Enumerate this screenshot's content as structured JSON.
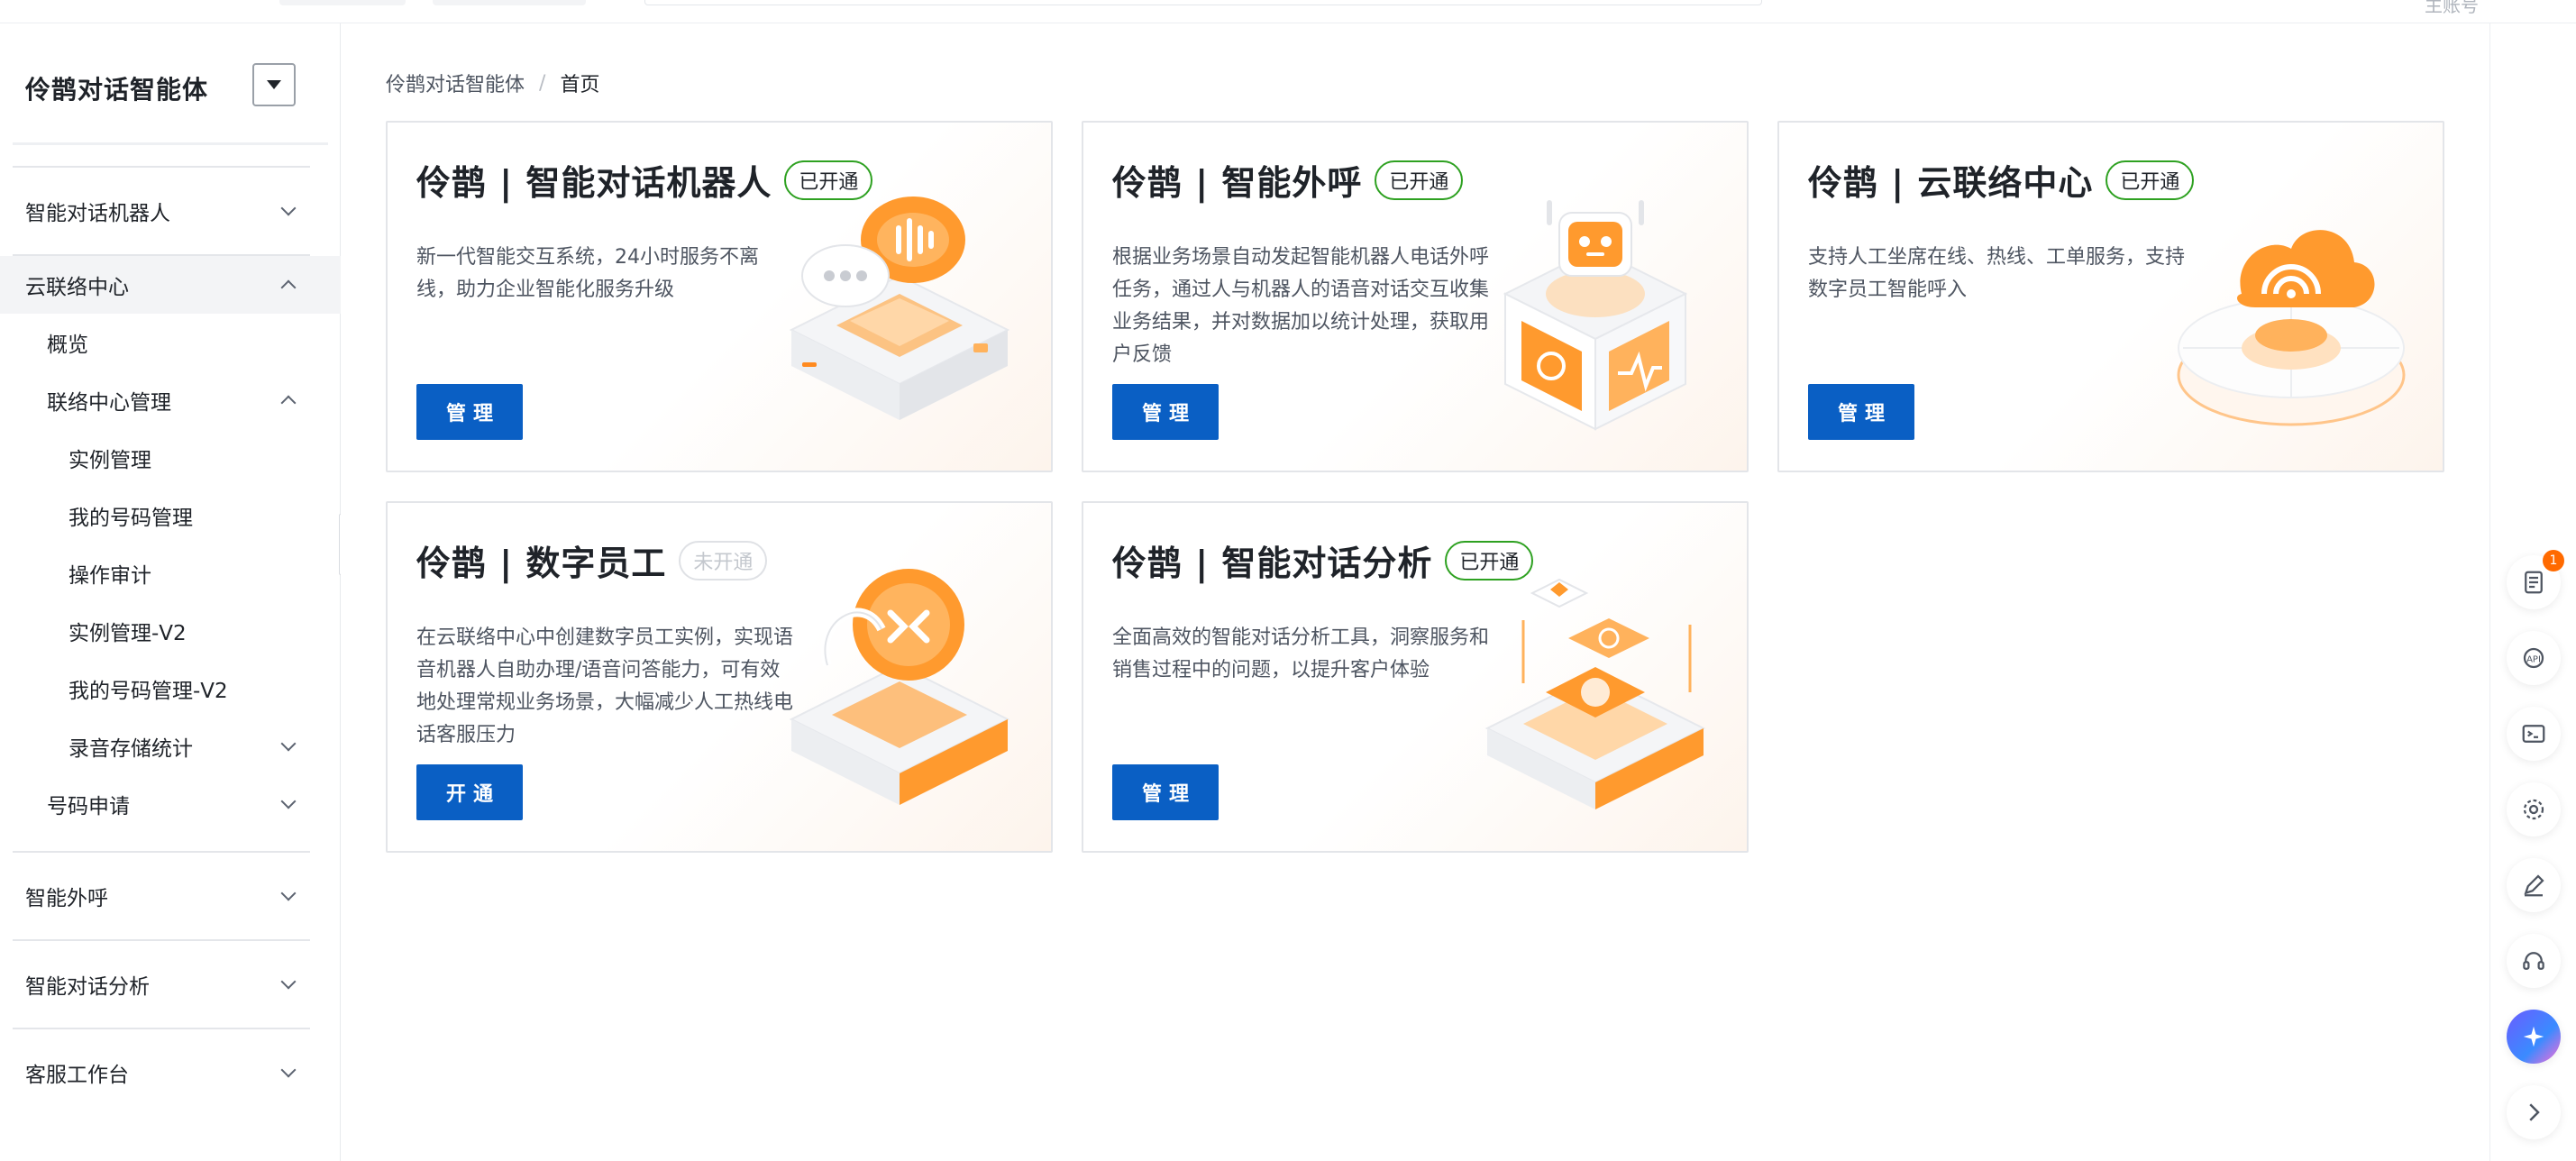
{
  "topbar": {
    "account_label": "主账号"
  },
  "sidebar": {
    "product_title": "伶鹊对话智能体",
    "items": [
      {
        "label": "智能对话机器人"
      },
      {
        "label": "云联络中心"
      },
      {
        "label": "概览"
      },
      {
        "label": "联络中心管理"
      },
      {
        "label": "实例管理"
      },
      {
        "label": "我的号码管理"
      },
      {
        "label": "操作审计"
      },
      {
        "label": "实例管理-V2"
      },
      {
        "label": "我的号码管理-V2"
      },
      {
        "label": "录音存储统计"
      },
      {
        "label": "号码申请"
      },
      {
        "label": "智能外呼"
      },
      {
        "label": "智能对话分析"
      },
      {
        "label": "客服工作台"
      }
    ]
  },
  "breadcrumb": {
    "root": "伶鹊对话智能体",
    "separator": "/",
    "current": "首页"
  },
  "cards": [
    {
      "title": "伶鹊 | 智能对话机器人",
      "status": "已开通",
      "desc": "新一代智能交互系统，24小时服务不离线，助力企业智能化服务升级",
      "button": "管理"
    },
    {
      "title": "伶鹊 | 智能外呼",
      "status": "已开通",
      "desc": "根据业务场景自动发起智能机器人电话外呼任务，通过人与机器人的语音对话交互收集业务结果，并对数据加以统计处理，获取用户反馈",
      "button": "管理"
    },
    {
      "title": "伶鹊 | 云联络中心",
      "status": "已开通",
      "desc": "支持人工坐席在线、热线、工单服务，支持数字员工智能呼入",
      "button": "管理"
    },
    {
      "title": "伶鹊 | 数字员工",
      "status": "未开通",
      "desc": "在云联络中心中创建数字员工实例，实现语音机器人自助办理/语音问答能力，可有效地处理常规业务场景，大幅减少人工热线电话客服压力",
      "button": "开通"
    },
    {
      "title": "伶鹊 | 智能对话分析",
      "status": "已开通",
      "desc": "全面高效的智能对话分析工具，洞察服务和销售过程中的问题，以提升客户体验",
      "button": "管理"
    }
  ],
  "rail": {
    "notification_count": "1"
  },
  "colors": {
    "primary": "#0a5fc4",
    "accent_orange": "#ff8a1f",
    "success": "#2ea121"
  }
}
